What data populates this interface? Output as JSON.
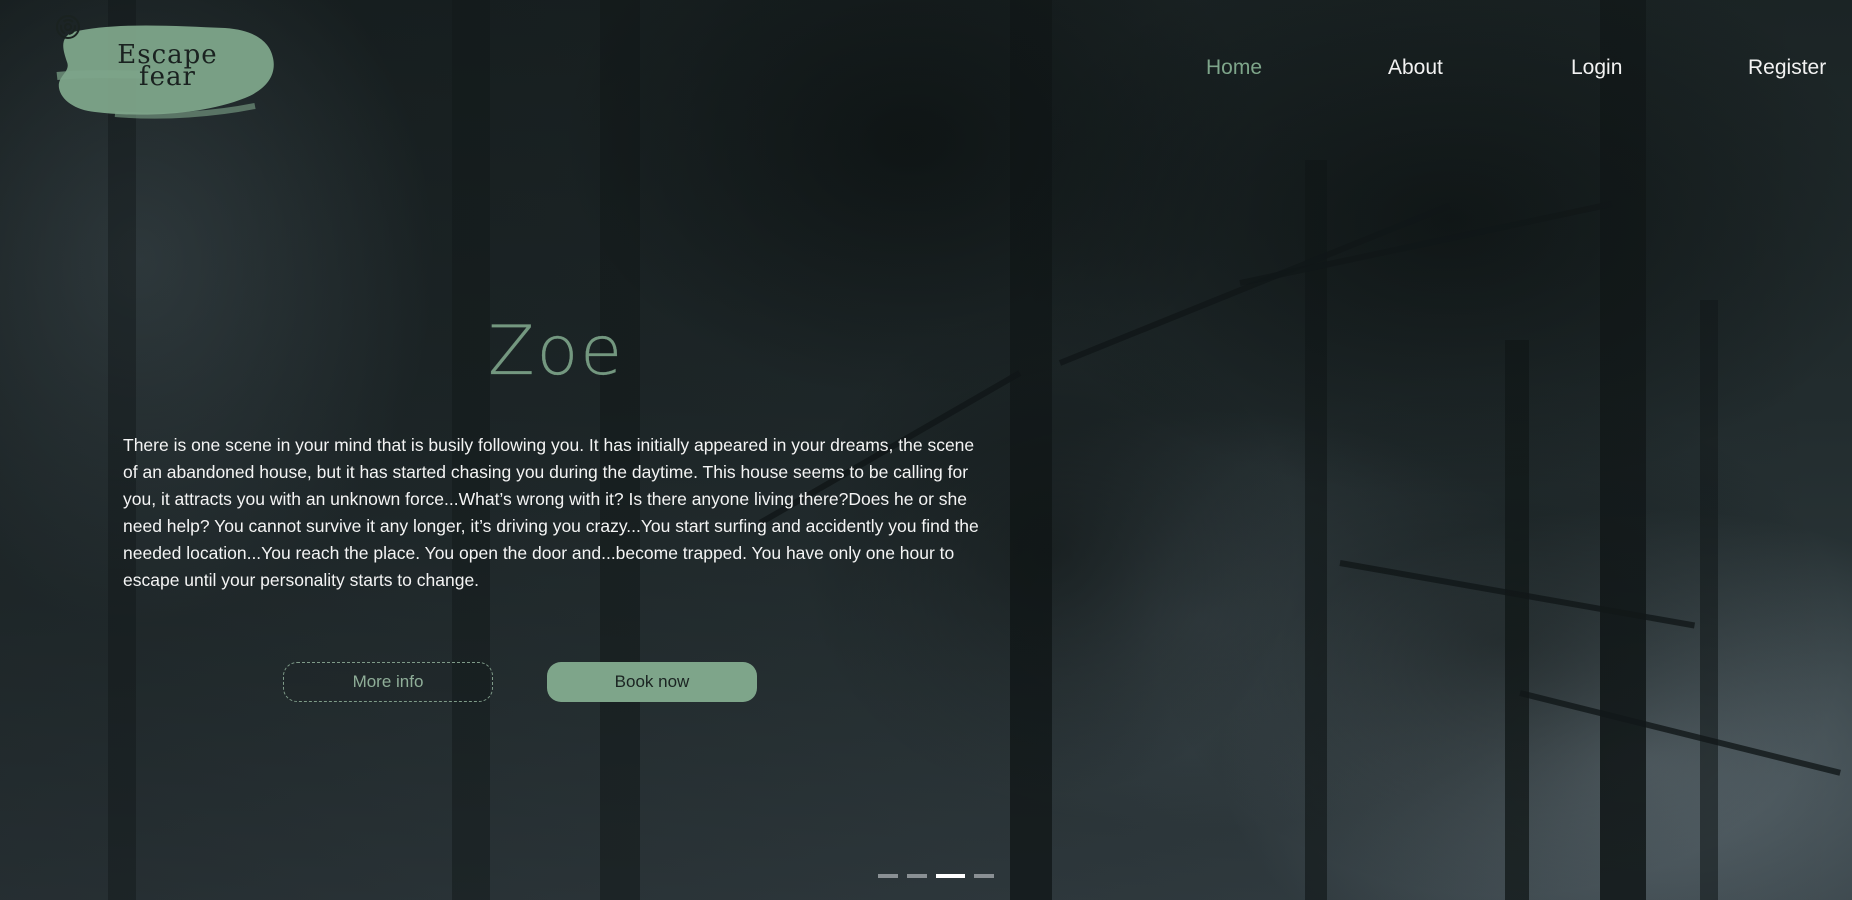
{
  "logo": {
    "line1": "Escape",
    "line2": "fear",
    "mark_icon": "maze-icon",
    "brush_color": "#7ea58a"
  },
  "nav": {
    "items": [
      {
        "label": "Home",
        "active": true
      },
      {
        "label": "About",
        "active": false
      },
      {
        "label": "Login",
        "active": false
      },
      {
        "label": "Register",
        "active": false
      }
    ],
    "active_color": "#7ea58a"
  },
  "hero": {
    "title": "Zoe",
    "description": "There is one scene in your mind that is busily following you. It has initially appeared in your dreams, the scene of an abandoned house, but it has started chasing you during the daytime. This house seems to be calling for you, it attracts you with an unknown force...What’s wrong with it? Is there anyone living there?Does he or she need help? You cannot survive it any longer, it’s driving you crazy...You start surfing and accidently you find the needed location...You reach the place. You open the door and...become trapped. You have only one hour to escape until your personality starts to change.",
    "more_info_label": "More info",
    "book_now_label": "Book now"
  },
  "slider": {
    "count": 4,
    "active_index": 2
  },
  "colors": {
    "accent": "#7ea58a",
    "text": "#f4f4f4"
  }
}
